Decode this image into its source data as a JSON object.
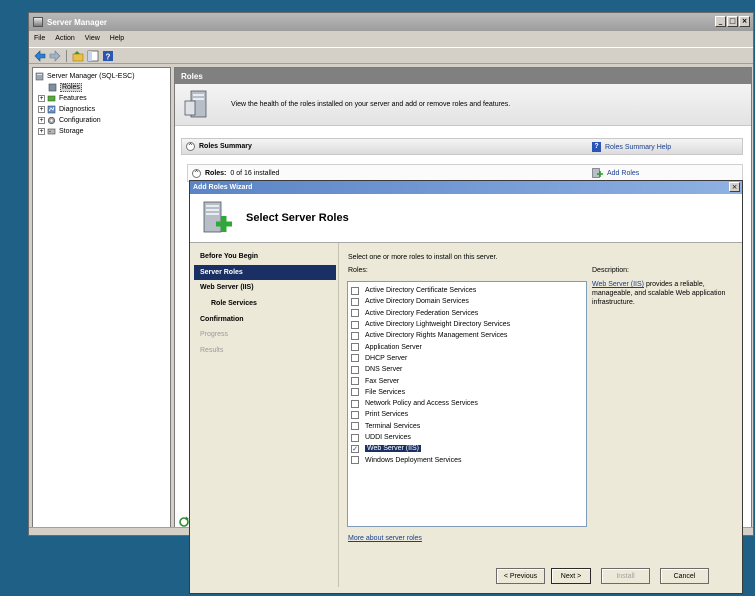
{
  "server_manager": {
    "title": "Server Manager",
    "menu": [
      "File",
      "Action",
      "View",
      "Help"
    ],
    "tree": {
      "root": "Server Manager (SQL-ESC)",
      "items": [
        "Roles",
        "Features",
        "Diagnostics",
        "Configuration",
        "Storage"
      ]
    },
    "pane_title": "Roles",
    "intro_text": "View the health of the roles installed on your server and add or remove roles and features.",
    "roles_summary": "Roles Summary",
    "roles_summary_help": "Roles Summary Help",
    "roles_label": "Roles:",
    "roles_count": "0 of 16 installed",
    "add_roles": "Add Roles"
  },
  "wizard": {
    "title": "Add Roles Wizard",
    "header": "Select Server Roles",
    "nav": [
      {
        "label": "Before You Begin",
        "state": "normal"
      },
      {
        "label": "Server Roles",
        "state": "active"
      },
      {
        "label": "Web Server (IIS)",
        "state": "normal"
      },
      {
        "label": "Role Services",
        "state": "sub"
      },
      {
        "label": "Confirmation",
        "state": "bold"
      },
      {
        "label": "Progress",
        "state": "disabled"
      },
      {
        "label": "Results",
        "state": "disabled"
      }
    ],
    "instruction": "Select one or more roles to install on this server.",
    "roles_label": "Roles:",
    "roles": [
      {
        "label": "Active Directory Certificate Services",
        "checked": false
      },
      {
        "label": "Active Directory Domain Services",
        "checked": false
      },
      {
        "label": "Active Directory Federation Services",
        "checked": false
      },
      {
        "label": "Active Directory Lightweight Directory Services",
        "checked": false
      },
      {
        "label": "Active Directory Rights Management Services",
        "checked": false
      },
      {
        "label": "Application Server",
        "checked": false
      },
      {
        "label": "DHCP Server",
        "checked": false
      },
      {
        "label": "DNS Server",
        "checked": false
      },
      {
        "label": "Fax Server",
        "checked": false
      },
      {
        "label": "File Services",
        "checked": false
      },
      {
        "label": "Network Policy and Access Services",
        "checked": false
      },
      {
        "label": "Print Services",
        "checked": false
      },
      {
        "label": "Terminal Services",
        "checked": false
      },
      {
        "label": "UDDI Services",
        "checked": false
      },
      {
        "label": "Web Server (IIS)",
        "checked": true
      },
      {
        "label": "Windows Deployment Services",
        "checked": false
      }
    ],
    "description_label": "Description:",
    "description_link": "Web Server (IIS)",
    "description_text": " provides a reliable, manageable, and scalable Web application infrastructure.",
    "more_link": "More about server roles",
    "buttons": {
      "previous": "< Previous",
      "next": "Next >",
      "install": "Install",
      "cancel": "Cancel"
    }
  }
}
